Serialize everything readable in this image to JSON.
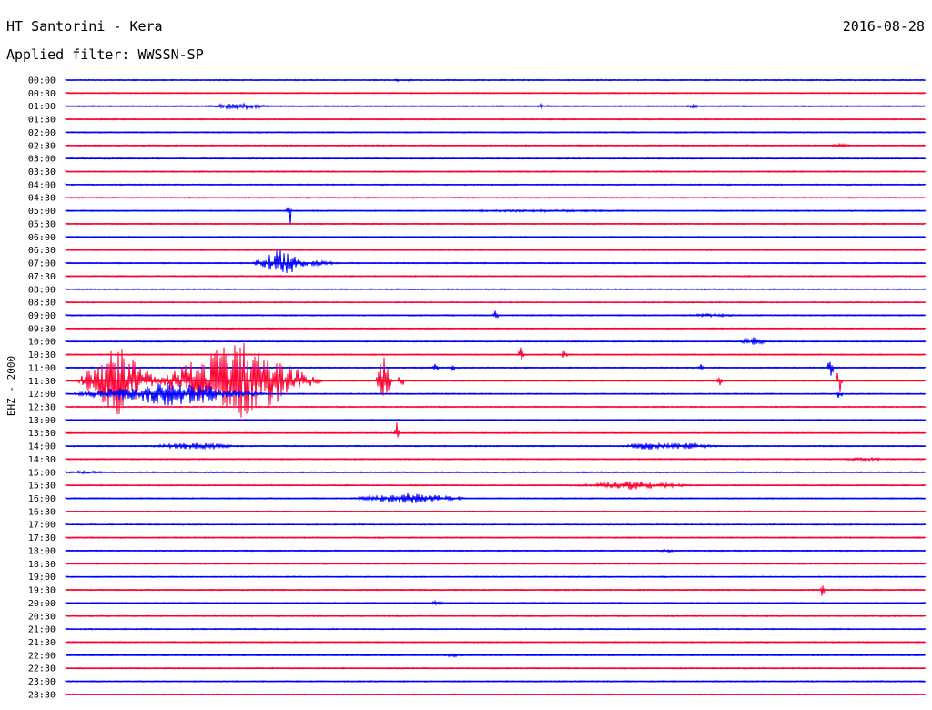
{
  "header": {
    "station": "HT Santorini - Kera",
    "date": "2016-08-28",
    "filter": "Applied filter: WWSSN-SP"
  },
  "chart_data": {
    "type": "line",
    "ylabel": "EHZ - 2000",
    "colors": {
      "even": "#0000ff",
      "odd": "#ff0033"
    },
    "rows": [
      {
        "label": "00:00",
        "events": [
          {
            "x": 0.39,
            "amp": 2,
            "width": 0.02
          }
        ]
      },
      {
        "label": "00:30",
        "events": []
      },
      {
        "label": "01:00",
        "events": [
          {
            "x": 0.2,
            "amp": 4,
            "width": 0.045
          },
          {
            "x": 0.555,
            "amp": 4,
            "width": 0.01
          },
          {
            "x": 0.73,
            "amp": 3,
            "width": 0.01
          }
        ]
      },
      {
        "label": "01:30",
        "events": []
      },
      {
        "label": "02:00",
        "events": []
      },
      {
        "label": "02:30",
        "events": [
          {
            "x": 0.9,
            "amp": 2,
            "width": 0.02
          }
        ]
      },
      {
        "label": "03:00",
        "events": []
      },
      {
        "label": "03:30",
        "events": []
      },
      {
        "label": "04:00",
        "events": []
      },
      {
        "label": "04:30",
        "events": []
      },
      {
        "label": "05:00",
        "events": [
          {
            "x": 0.26,
            "amp": 24,
            "width": 0.004
          },
          {
            "x": 0.55,
            "amp": 1.5,
            "width": 0.2
          }
        ]
      },
      {
        "label": "05:30",
        "events": []
      },
      {
        "label": "06:00",
        "events": []
      },
      {
        "label": "06:30",
        "events": []
      },
      {
        "label": "07:00",
        "events": [
          {
            "x": 0.25,
            "amp": 16,
            "width": 0.035
          },
          {
            "x": 0.29,
            "amp": 3,
            "width": 0.04
          }
        ]
      },
      {
        "label": "07:30",
        "events": []
      },
      {
        "label": "08:00",
        "events": []
      },
      {
        "label": "08:30",
        "events": []
      },
      {
        "label": "09:00",
        "events": [
          {
            "x": 0.5,
            "amp": 5,
            "width": 0.004
          },
          {
            "x": 0.75,
            "amp": 2,
            "width": 0.05
          }
        ]
      },
      {
        "label": "09:30",
        "events": []
      },
      {
        "label": "10:00",
        "events": [
          {
            "x": 0.8,
            "amp": 5,
            "width": 0.02
          }
        ]
      },
      {
        "label": "10:30",
        "events": [
          {
            "x": 0.53,
            "amp": 14,
            "width": 0.004
          },
          {
            "x": 0.58,
            "amp": 6,
            "width": 0.004
          }
        ]
      },
      {
        "label": "11:00",
        "events": [
          {
            "x": 0.43,
            "amp": 5,
            "width": 0.004
          },
          {
            "x": 0.45,
            "amp": 5,
            "width": 0.004
          },
          {
            "x": 0.74,
            "amp": 5,
            "width": 0.004
          },
          {
            "x": 0.89,
            "amp": 12,
            "width": 0.004
          }
        ]
      },
      {
        "label": "11:30",
        "events": [
          {
            "x": 0.06,
            "amp": 40,
            "width": 0.05
          },
          {
            "x": 0.2,
            "amp": 45,
            "width": 0.1
          },
          {
            "x": 0.37,
            "amp": 30,
            "width": 0.01
          },
          {
            "x": 0.39,
            "amp": 10,
            "width": 0.004
          },
          {
            "x": 0.76,
            "amp": 6,
            "width": 0.004
          },
          {
            "x": 0.9,
            "amp": 16,
            "width": 0.004
          }
        ]
      },
      {
        "label": "12:00",
        "events": [
          {
            "x": 0.12,
            "amp": 14,
            "width": 0.12
          },
          {
            "x": 0.9,
            "amp": 8,
            "width": 0.004
          }
        ]
      },
      {
        "label": "12:30",
        "events": []
      },
      {
        "label": "13:00",
        "events": []
      },
      {
        "label": "13:30",
        "events": [
          {
            "x": 0.385,
            "amp": 14,
            "width": 0.004
          }
        ]
      },
      {
        "label": "14:00",
        "events": [
          {
            "x": 0.15,
            "amp": 4,
            "width": 0.07
          },
          {
            "x": 0.68,
            "amp": 5,
            "width": 0.04
          },
          {
            "x": 0.72,
            "amp": 4,
            "width": 0.05
          }
        ]
      },
      {
        "label": "14:30",
        "events": [
          {
            "x": 0.93,
            "amp": 2,
            "width": 0.05
          }
        ]
      },
      {
        "label": "15:00",
        "events": [
          {
            "x": 0.02,
            "amp": 2,
            "width": 0.04
          }
        ]
      },
      {
        "label": "15:30",
        "events": [
          {
            "x": 0.66,
            "amp": 5,
            "width": 0.08
          }
        ]
      },
      {
        "label": "16:00",
        "events": [
          {
            "x": 0.4,
            "amp": 6,
            "width": 0.08
          }
        ]
      },
      {
        "label": "16:30",
        "events": []
      },
      {
        "label": "17:00",
        "events": []
      },
      {
        "label": "17:30",
        "events": []
      },
      {
        "label": "18:00",
        "events": [
          {
            "x": 0.7,
            "amp": 2,
            "width": 0.02
          }
        ]
      },
      {
        "label": "18:30",
        "events": []
      },
      {
        "label": "19:00",
        "events": []
      },
      {
        "label": "19:30",
        "events": [
          {
            "x": 0.88,
            "amp": 9,
            "width": 0.004
          }
        ]
      },
      {
        "label": "20:00",
        "events": [
          {
            "x": 0.43,
            "amp": 2,
            "width": 0.02
          }
        ]
      },
      {
        "label": "20:30",
        "events": []
      },
      {
        "label": "21:00",
        "events": []
      },
      {
        "label": "21:30",
        "events": []
      },
      {
        "label": "22:00",
        "events": [
          {
            "x": 0.45,
            "amp": 2,
            "width": 0.02
          }
        ]
      },
      {
        "label": "22:30",
        "events": []
      },
      {
        "label": "23:00",
        "events": []
      },
      {
        "label": "23:30",
        "events": []
      }
    ]
  }
}
